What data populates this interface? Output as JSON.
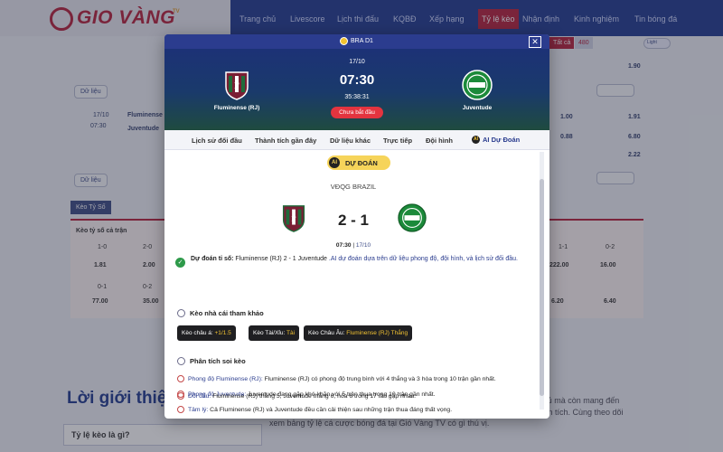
{
  "site": {
    "logo_text": "GIO VÀNG",
    "logo_tv": "TV",
    "nav": [
      "Trang chủ",
      "Livescore",
      "Lịch thi đấu",
      "KQBĐ",
      "Xếp hạng",
      "Tỷ lệ kèo",
      "Nhận định",
      "Kinh nghiệm",
      "Tin bóng đá"
    ],
    "nav_active_index": 5,
    "light_toggle": "Light",
    "tatca_label": "Tất cả",
    "tatca_count": "480"
  },
  "background": {
    "data_button": "Dữ liệu",
    "match_date": "17/10",
    "match_time": "07:30",
    "home": "Fluminense (RJ)",
    "away": "Juventude",
    "odds": [
      "1.90",
      "1.00",
      "1.91",
      "0.88",
      "6.80",
      "2.22"
    ],
    "tab_label": "Kèo Tỷ Số",
    "table_header": "Kèo tỷ số cả trận",
    "table_cells": [
      "1-0",
      "1.81",
      "2-0",
      "2.00",
      "0-1",
      "77.00",
      "0-2",
      "35.00",
      "1-1",
      "222.00",
      "0-2",
      "16.00",
      "6.20",
      "6.40"
    ],
    "intro_title": "Lời giới thiệu",
    "intro_box": "Tỷ lệ kèo là gì?",
    "intro_para": "tỷ lệ kèo nhà cái là ... TV, bằng keonhacai không chỉ cung cấp thông tin đầy đủ mà còn mang đến những trải nghiệm chuyên nghiệp, hỗ trợ người chơi dễ dàng theo dõi và phân tích. Cùng theo dõi xem bảng tỷ lệ cá cược bóng đá tại Gió Vàng TV có gì thú vị."
  },
  "modal": {
    "league": "BRA D1",
    "date": "17/10",
    "time": "07:30",
    "countdown": "35:38:31",
    "status": "Chưa bắt đầu",
    "home_team": "Fluminense (RJ)",
    "away_team": "Juventude",
    "tabs": [
      "Lịch sử đối đầu",
      "Thành tích gần đây",
      "Dữ liệu khác",
      "Trực tiếp",
      "Đội hình",
      "AI Dự Đoán"
    ],
    "ai_badge": "DỰ ĐOÁN",
    "ai_circle": "AI",
    "competition": "VĐQG BRAZIL",
    "score": "2 - 1",
    "meta_time": "07:30",
    "meta_sep": " | ",
    "meta_date": "17/10",
    "prediction_key": "Dự đoán tỉ số: ",
    "prediction_value": "Fluminense (RJ) 2 - 1 Juventude",
    "prediction_note": " .AI dự đoán dựa trên dữ liệu phong độ, đội hình, và lịch sử đối đầu.",
    "bookmaker_title": "Kèo nhà cái tham khảo",
    "odds_chips": [
      {
        "label": "Kèo châu á: ",
        "value": "+1/1.5"
      },
      {
        "label": "Kèo Tài/Xỉu: ",
        "value": "Tài"
      },
      {
        "label": "Kèo Châu Âu: ",
        "value": "Fluminense (RJ) Thắng"
      }
    ],
    "analysis_title": "Phân tích soi kèo",
    "analysis": [
      {
        "label": "Phong độ Fluminense (RJ):",
        "text": " Fluminense (RJ) có phong độ trung bình với 4 thắng và 3 hòa trong 10 trận gần nhất."
      },
      {
        "label": "Phong độ Juventude:",
        "text": " Juventude đang gặp khó khăn với 5 trận thua trong 10 trận gần nhất."
      },
      {
        "label": "Tâm lý:",
        "text": " Cả Fluminense (RJ) và Juventude đều cần cải thiện sau những trận thua đáng thất vọng."
      },
      {
        "label": "Đối đầu:",
        "text": " Fluminense (RJ) thắng 5, Juventude thắng 6, hòa 6 trong 17 lần gặp nhau."
      }
    ],
    "close_symbol": "✕",
    "check_symbol": "✓"
  },
  "colors": {
    "brand_red": "#b5203b",
    "brand_blue": "#1f3a8f",
    "ai_yellow": "#f6d45a"
  }
}
